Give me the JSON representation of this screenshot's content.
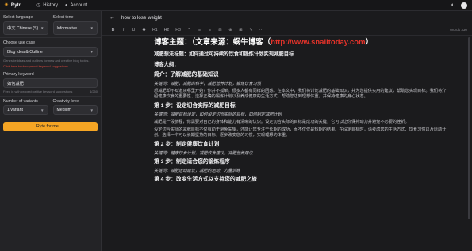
{
  "nav": {
    "brand": "Rytr",
    "history": "History",
    "account": "Account"
  },
  "sidebar": {
    "language_label": "Select language",
    "language_value": "中文 Chinese (S)",
    "tone_label": "Select tone",
    "tone_value": "Informative",
    "usecase_label": "Choose use case",
    "usecase_value": "Blog Idea & Outline",
    "usecase_hint": "Generate ideas and outlines for new and creative blog topics.",
    "usecase_hint_link": "Click here to view preset keyword suggestions.",
    "keyword_label": "Primary keyword",
    "keyword_value": "如何减肥",
    "keyword_hint": "Feed in with proper/positive keyword suggestions",
    "keyword_counter": "4/250",
    "variants_label": "Number of variants",
    "variants_value": "1 variant",
    "creativity_label": "Creativity level",
    "creativity_value": "Medium",
    "ryte_button": "Ryte for me"
  },
  "editor": {
    "doc_title": "how to lose weight",
    "toolbar": [
      "B",
      "I",
      "U",
      "S",
      "H1",
      "H2",
      "H3",
      "\"",
      "≡",
      "≡",
      "⊟",
      "⊕",
      "⊞",
      "✎",
      "⋯"
    ],
    "word_count": "Words 330",
    "title_prefix": "博客主题：（文章来源：蜗牛博客（",
    "title_url": "http://www.snailtoday.com",
    "title_suffix": "）",
    "blocks": [
      {
        "type": "bold",
        "text": "减肥想法标题：如何通过可持续的饮食和锻炼计划实现减肥目标"
      },
      {
        "type": "bold",
        "text": "博客大纲："
      },
      {
        "type": "heading",
        "text": "简介：了解减肥的基础知识"
      },
      {
        "type": "italic",
        "text": "关键词：减肥，减肥的科学，减肥营养计划，锻炼饮食习惯"
      },
      {
        "type": "text",
        "text": "想减肥却不知道从哪里开始？你并不孤单。很多人都有同样的困惑。在本文中，我们将讨论减肥的基础知识，并为您提供实用的建议，帮助您实现目标。我们将介绍健康饮食的重要性、选择正确的锻炼计划以及养成健康的生活方式，帮助您达到理想体重，并保持健康的身心状态。"
      },
      {
        "type": "heading",
        "text": "第 1 步：设定切合实际的减肥目标"
      },
      {
        "type": "italic",
        "text": "关键词：减肥目标设定，如何设定切合实际的目标，如何制定减肥计划"
      },
      {
        "type": "text",
        "text": "减肥是一段旅程，你需要对自己的身体和能力有清晰的认识。设定切合实际的目标是成功的关键，它可以让你保持动力并避免不必要的挫折。"
      },
      {
        "type": "text",
        "text": "设定切合实际的减肥目标不仅有助于避免失望，还能让您专注于长期的成功，而不仅仅是短期的结果。在设定目标时，请考虑您的生活方式、饮食习惯以及运动计划。选择一个可以长期坚持的目标，逐步改变您的习惯，实现理想的体重。"
      },
      {
        "type": "heading",
        "text": "第 2 步：制定健康饮食计划"
      },
      {
        "type": "italic",
        "text": "关键词：健康饮食计划，减肥饮食建议，减肥营养建议"
      },
      {
        "type": "heading",
        "text": "第 3 步：制定适合您的锻炼程序"
      },
      {
        "type": "italic",
        "text": "关键词：减肥运动建议，减肥的运动，力量训练"
      },
      {
        "type": "heading",
        "text": "第 4 步：改变生活方式以支持您的减肥之旅"
      }
    ]
  },
  "colors": {
    "accent": "#f5a524",
    "link_red": "#e5332a",
    "background": "#1b1b1d",
    "sidebar": "#232326"
  },
  "icons": [
    "rytr-logo-icon",
    "history-icon",
    "account-icon",
    "theme-toggle-icon",
    "back-arrow-icon",
    "chevron-down-icon"
  ]
}
